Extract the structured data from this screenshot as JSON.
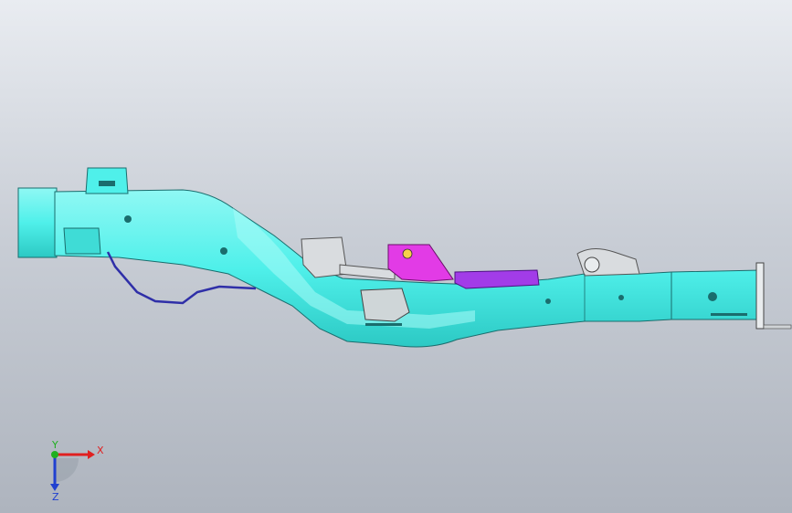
{
  "viewport": {
    "background_top": "#e9ecf1",
    "background_bottom": "#aeb4be"
  },
  "model": {
    "frame_color": "#4ff0ea",
    "frame_edge_color": "#1a6d6d",
    "bracket_color": "#d9dcdf",
    "mount_magenta_color": "#e23be6",
    "mount_purple_color": "#a23ce8",
    "cable_color": "#2f2fa8"
  },
  "triad": {
    "x_label": "X",
    "y_label": "Y",
    "z_label": "Z",
    "x_color": "#e02020",
    "y_color": "#20b020",
    "z_color": "#2040d0"
  }
}
